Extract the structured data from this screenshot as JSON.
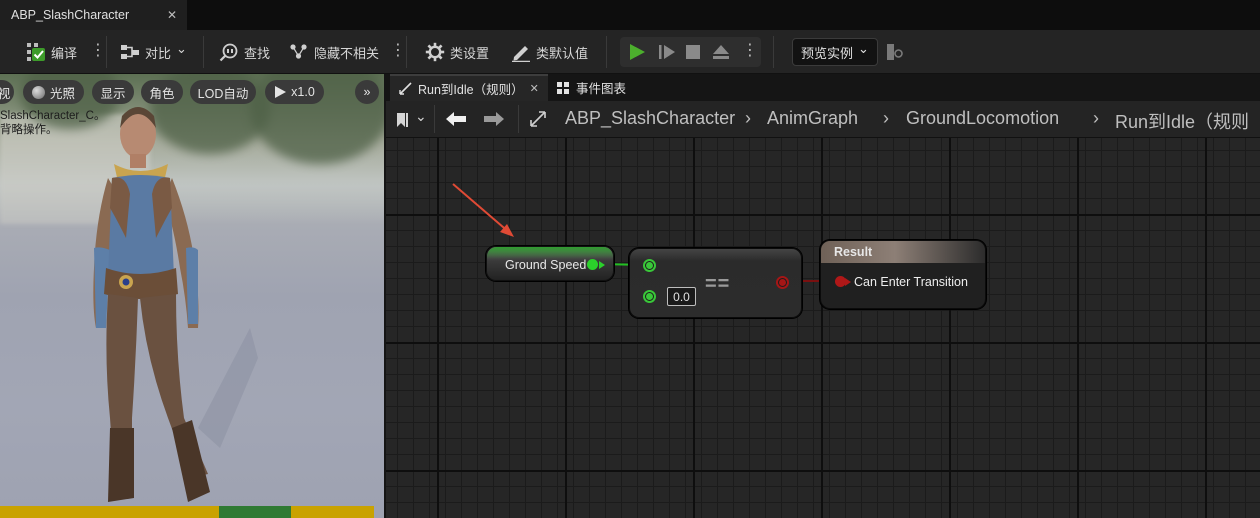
{
  "window": {
    "tab_title": "ABP_SlashCharacter",
    "tab_close": "✕"
  },
  "toolbar": {
    "compile": "编译",
    "diff": "对比",
    "find": "查找",
    "hide_unrelated": "隐藏不相关",
    "class_settings": "类设置",
    "class_defaults": "类默认值",
    "preview_instance": "预览实例",
    "more": "⋮",
    "chevron": "⌄",
    "accent_green": "#4caf2d"
  },
  "viewport": {
    "buttons": {
      "view": "视",
      "lit": "光照",
      "show": "显示",
      "character": "角色",
      "lod": "LOD自动",
      "speed": "x1.0",
      "more": "»"
    },
    "info_line1": "SlashCharacter_C。",
    "info_line2": "背略操作。",
    "bottom_bar_color": "#c9a200"
  },
  "graph_tabs": [
    {
      "label": "Run到Idle（规则）",
      "close": "✕"
    },
    {
      "label": "事件图表"
    }
  ],
  "breadcrumb": {
    "items": [
      "ABP_SlashCharacter",
      "AnimGraph",
      "GroundLocomotion",
      "Run到Idle（规则"
    ],
    "separator": "›"
  },
  "nodes": {
    "getter": {
      "label": "Ground Speed",
      "pin_color": "#2bd02b"
    },
    "equals": {
      "operator": "==",
      "default_value": "0.0"
    },
    "result": {
      "header": "Result",
      "pin_label": "Can Enter Transition",
      "pin_color": "#a51616"
    }
  },
  "annotation": {
    "arrow_color": "#e04a35"
  }
}
